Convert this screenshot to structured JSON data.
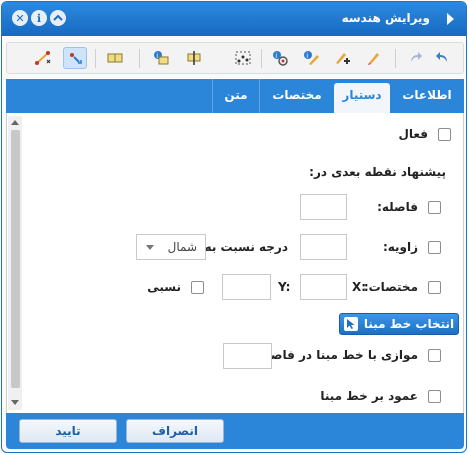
{
  "window": {
    "title": "ویرایش هندسه"
  },
  "toolbar": {
    "buttons": [
      {
        "name": "undo",
        "icon": "undo-icon"
      },
      {
        "name": "redo",
        "icon": "redo-icon"
      },
      {
        "name": "draw-line",
        "icon": "pencil-icon"
      },
      {
        "name": "add-vertex",
        "icon": "add-vertex-icon"
      },
      {
        "name": "edit-vertex",
        "icon": "edit-vertex-icon"
      },
      {
        "name": "snap-settings",
        "icon": "snap-icon"
      },
      {
        "name": "select-vertices",
        "icon": "select-vertices-icon"
      },
      {
        "name": "move",
        "icon": "move-icon"
      },
      {
        "name": "split",
        "icon": "split-icon"
      },
      {
        "name": "rectangle",
        "icon": "rectangle-icon"
      },
      {
        "name": "point-tool",
        "icon": "point-icon",
        "active": true
      },
      {
        "name": "line-tool",
        "icon": "polyline-icon"
      }
    ]
  },
  "tabs": [
    {
      "label": "اطلاعات",
      "active": false
    },
    {
      "label": "دستیار",
      "active": true
    },
    {
      "label": "مختصات",
      "active": false
    },
    {
      "label": "متن",
      "active": false
    }
  ],
  "assistant": {
    "active_label": "فعال",
    "suggest_heading": "پیشنهاد نقطه بعدی در:",
    "distance_label": "فاصله:",
    "angle_label": "زاویه:",
    "angle_relative_label": "درجه نسبت به:",
    "angle_reference": "شمال",
    "coords_label": "مختصات:",
    "x_label": "X:",
    "y_label": "Y:",
    "relative_label": "نسبی",
    "select_baseline_button": "انتخاب خط مبنا",
    "parallel_label": "موازی با خط مبنا در فاصله:",
    "perpendicular_label": "عمود بر خط مبنا"
  },
  "footer": {
    "cancel_label": "انصراف",
    "confirm_label": "تایید"
  },
  "colors": {
    "accent": "#2b86d9",
    "title_bar": "#1c72c4"
  }
}
